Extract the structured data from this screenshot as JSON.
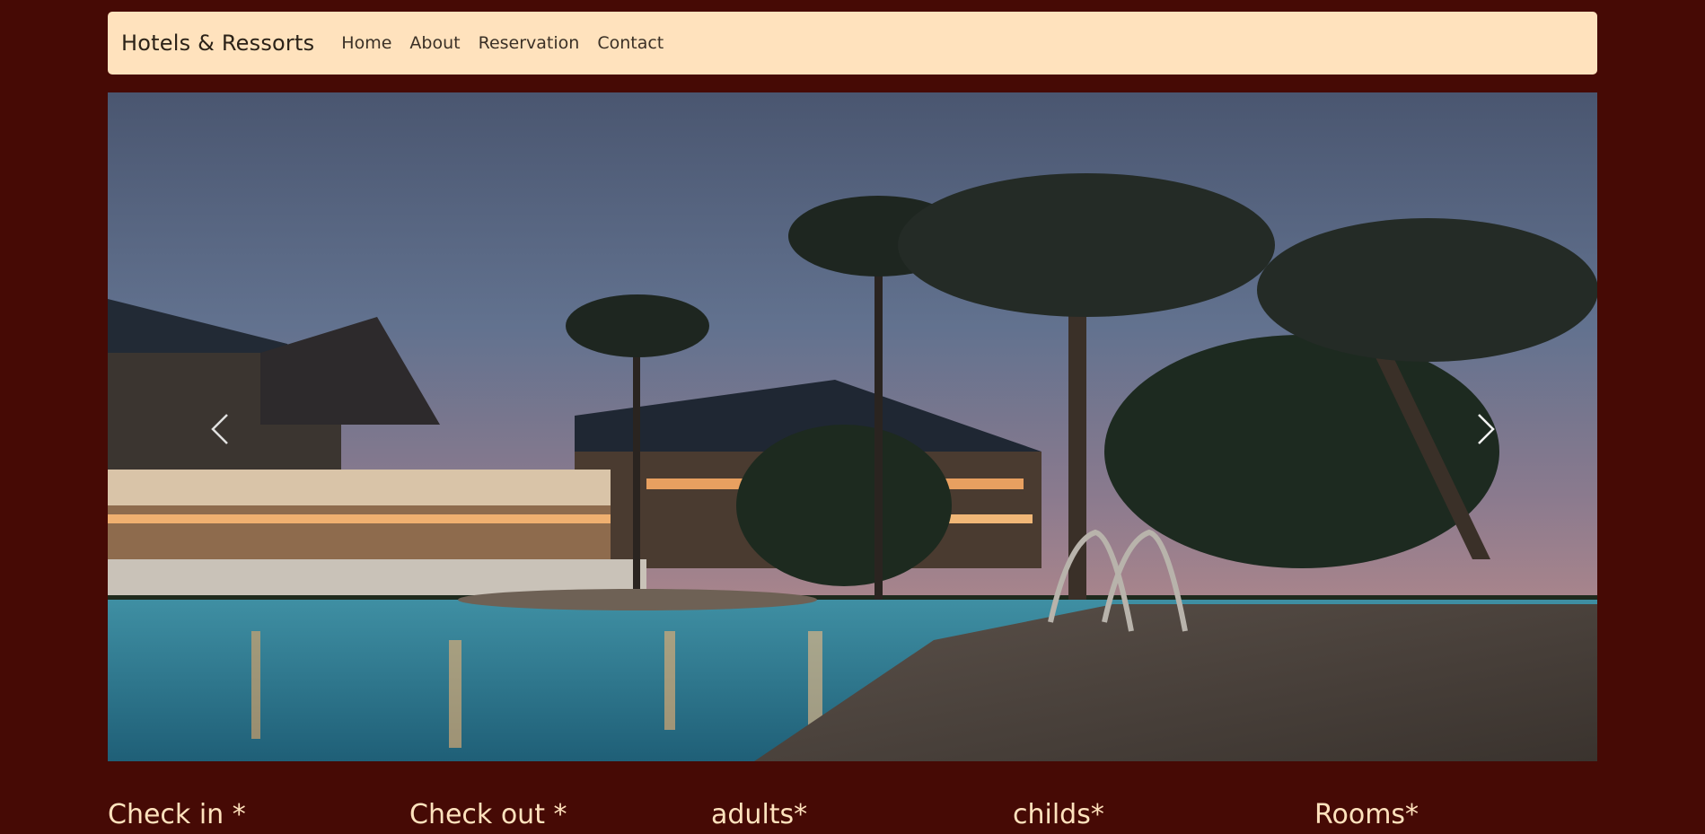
{
  "navbar": {
    "brand": "Hotels & Ressorts",
    "links": [
      "Home",
      "About",
      "Reservation",
      "Contact"
    ]
  },
  "carousel": {
    "image": "hotel-pool-at-dusk-with-palm-trees",
    "prev_icon": "chevron-left-icon",
    "next_icon": "chevron-right-icon"
  },
  "booking_form": {
    "labels": [
      "Check in *",
      "Check out *",
      "adults*",
      "childs*",
      "Rooms*"
    ]
  },
  "colors": {
    "page_background": "#460a05",
    "navbar_background": "#ffe2bd",
    "form_label_text": "#ffe2bd"
  }
}
